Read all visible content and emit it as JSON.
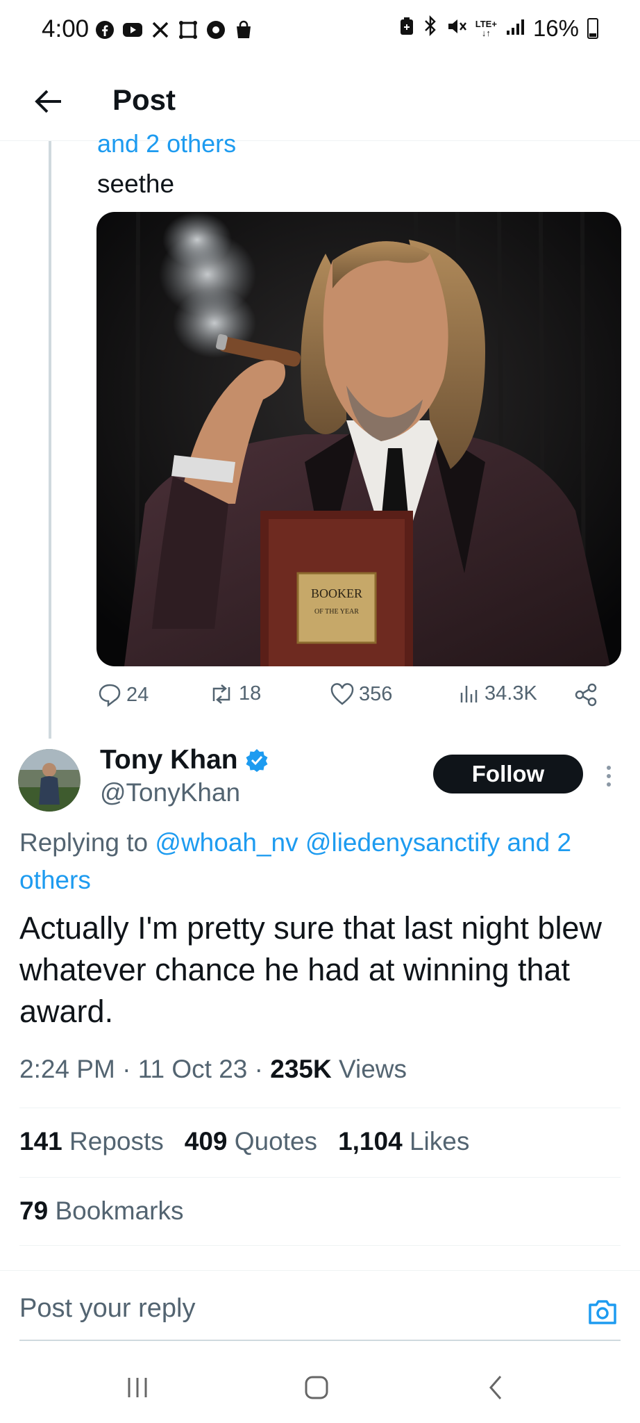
{
  "status_bar": {
    "time": "4:00",
    "battery": "16%",
    "network": "LTE+",
    "left_icons": [
      "facebook-icon",
      "youtube-icon",
      "x-icon",
      "link-icon",
      "chrome-icon",
      "shopping-bag-icon"
    ],
    "right_icons": [
      "battery-saver-icon",
      "bluetooth-icon",
      "mute-icon",
      "lte-icon",
      "signal-icon",
      "battery-icon"
    ]
  },
  "header": {
    "title": "Post",
    "back_icon": "arrow-left-icon"
  },
  "previous_post": {
    "replying_cut": "and 2 others",
    "text": "seethe",
    "image_caption": "BOOKER",
    "image_caption_sub": "OF THE YEAR",
    "actions": {
      "replies": "24",
      "reposts": "18",
      "likes": "356",
      "views": "34.3K"
    }
  },
  "author": {
    "name": "Tony Khan",
    "handle": "@TonyKhan",
    "verified": true,
    "follow_label": "Follow"
  },
  "reply": {
    "prefix": "Replying to ",
    "mention1": "@whoah_nv",
    "mention2": "@liedenysanctify",
    "and_others": "and 2 others",
    "body": "Actually I'm pretty sure that last night blew whatever chance he had at winning that award."
  },
  "meta": {
    "time": "2:24 PM",
    "sep": "·",
    "date": "11 Oct 23",
    "views_count": "235K",
    "views_label": "Views"
  },
  "stats": {
    "reposts_count": "141",
    "reposts_label": "Reposts",
    "quotes_count": "409",
    "quotes_label": "Quotes",
    "likes_count": "1,104",
    "likes_label": "Likes",
    "bookmarks_count": "79",
    "bookmarks_label": "Bookmarks"
  },
  "composer": {
    "placeholder": "Post your reply"
  },
  "colors": {
    "accent": "#1d9bf0",
    "text": "#0f1419",
    "muted": "#536471",
    "follow_bg": "#0f1419"
  }
}
